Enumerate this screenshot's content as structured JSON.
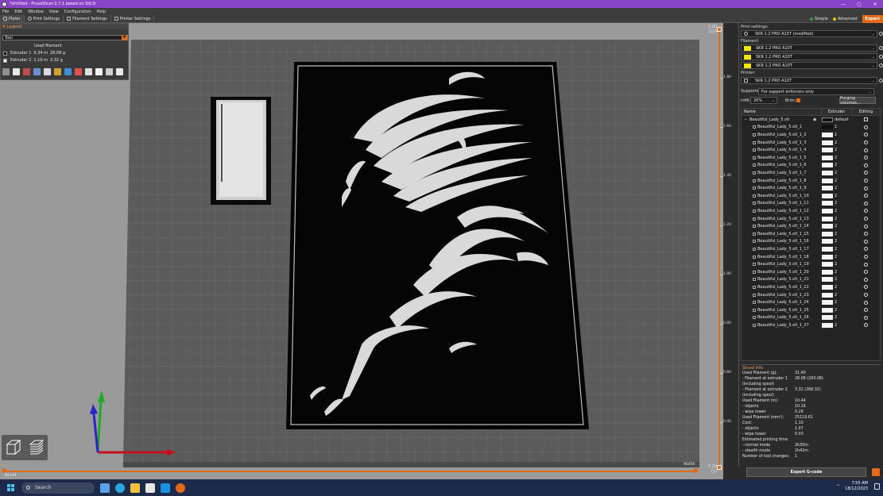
{
  "window": {
    "title": "*Untitled - PrusaSlicer-2.7.1 based on Slic3r",
    "controls": [
      "—",
      "▢",
      "✕"
    ]
  },
  "menu": [
    "File",
    "Edit",
    "Window",
    "View",
    "Configuration",
    "Help"
  ],
  "tabs": [
    "Plater",
    "Print Settings",
    "Filament Settings",
    "Printer Settings"
  ],
  "modes": {
    "simple": "Simple",
    "advanced": "Advanced",
    "expert": "Expert",
    "simple_color": "#3aa33a",
    "advanced_color": "#e6c400"
  },
  "legend": {
    "title": "Legend",
    "view_type": "Tool",
    "used_filament_label": "Used filament",
    "extruders": [
      {
        "name": "Extruder 1",
        "length": "9.34 m",
        "weight": "28.08 g",
        "color": "#000000"
      },
      {
        "name": "Extruder 2",
        "length": "1.10 m",
        "weight": "3.32 g",
        "color": "#ffffff"
      }
    ]
  },
  "vslider": {
    "top_value": "2.00",
    "top_layer": "(10)",
    "bottom_value": "0.20",
    "bottom_layer": "(1)",
    "ticks": [
      "1.80",
      "1.60",
      "1.40",
      "1.20",
      "1.00",
      "0.80",
      "0.60",
      "0.40"
    ]
  },
  "hslider": {
    "left_value": "84149",
    "right_value": "96056"
  },
  "right_panel": {
    "print_settings_label": "Print settings:",
    "print_profile": "SKR 1.2 PRO A10T (modified)",
    "filament_label": "Filament:",
    "filaments": [
      {
        "name": "SKR 1.2 PRO A10T",
        "color": "#f2e600"
      },
      {
        "name": "SKR 1.2 PRO A10T",
        "color": "#f2e600"
      },
      {
        "name": "SKR 1.2 PRO A10T",
        "color": "#f2e600"
      }
    ],
    "printer_label": "Printer:",
    "printer_profile": "SKR 1.2 PRO A10T",
    "supports_label": "Supports:",
    "supports_value": "For support enforcers only",
    "infill_label": "Infill:",
    "infill_value": "20%",
    "brim_label": "Brim:",
    "purging_button": "Purging volumes...",
    "columns": {
      "name": "Name",
      "extruder": "Extruder",
      "editing": "Editing"
    },
    "parent_object": {
      "name": "Beautiful_Lady_5.stl",
      "extruder": "default"
    },
    "parts": [
      {
        "name": "Beautiful_Lady_5.stl_1",
        "extruder": "1",
        "color": "#111111"
      },
      {
        "name": "Beautiful_Lady_5.stl_1_2",
        "extruder": "2",
        "color": "#f4f4f4"
      },
      {
        "name": "Beautiful_Lady_5.stl_1_3",
        "extruder": "2",
        "color": "#f4f4f4"
      },
      {
        "name": "Beautiful_Lady_5.stl_1_4",
        "extruder": "2",
        "color": "#f4f4f4"
      },
      {
        "name": "Beautiful_Lady_5.stl_1_5",
        "extruder": "2",
        "color": "#f4f4f4"
      },
      {
        "name": "Beautiful_Lady_5.stl_1_6",
        "extruder": "2",
        "color": "#f4f4f4"
      },
      {
        "name": "Beautiful_Lady_5.stl_1_7",
        "extruder": "2",
        "color": "#f4f4f4"
      },
      {
        "name": "Beautiful_Lady_5.stl_1_8",
        "extruder": "2",
        "color": "#f4f4f4"
      },
      {
        "name": "Beautiful_Lady_5.stl_1_9",
        "extruder": "2",
        "color": "#f4f4f4"
      },
      {
        "name": "Beautiful_Lady_5.stl_1_10",
        "extruder": "2",
        "color": "#f4f4f4"
      },
      {
        "name": "Beautiful_Lady_5.stl_1_11",
        "extruder": "2",
        "color": "#f4f4f4"
      },
      {
        "name": "Beautiful_Lady_5.stl_1_12",
        "extruder": "2",
        "color": "#f4f4f4"
      },
      {
        "name": "Beautiful_Lady_5.stl_1_13",
        "extruder": "2",
        "color": "#f4f4f4"
      },
      {
        "name": "Beautiful_Lady_5.stl_1_14",
        "extruder": "2",
        "color": "#f4f4f4"
      },
      {
        "name": "Beautiful_Lady_5.stl_1_15",
        "extruder": "2",
        "color": "#f4f4f4"
      },
      {
        "name": "Beautiful_Lady_5.stl_1_16",
        "extruder": "2",
        "color": "#f4f4f4"
      },
      {
        "name": "Beautiful_Lady_5.stl_1_17",
        "extruder": "2",
        "color": "#f4f4f4"
      },
      {
        "name": "Beautiful_Lady_5.stl_1_18",
        "extruder": "2",
        "color": "#f4f4f4"
      },
      {
        "name": "Beautiful_Lady_5.stl_1_19",
        "extruder": "2",
        "color": "#f4f4f4"
      },
      {
        "name": "Beautiful_Lady_5.stl_1_20",
        "extruder": "2",
        "color": "#f4f4f4"
      },
      {
        "name": "Beautiful_Lady_5.stl_1_21",
        "extruder": "2",
        "color": "#f4f4f4"
      },
      {
        "name": "Beautiful_Lady_5.stl_1_22",
        "extruder": "2",
        "color": "#f4f4f4"
      },
      {
        "name": "Beautiful_Lady_5.stl_1_23",
        "extruder": "2",
        "color": "#f4f4f4"
      },
      {
        "name": "Beautiful_Lady_5.stl_1_24",
        "extruder": "2",
        "color": "#f4f4f4"
      },
      {
        "name": "Beautiful_Lady_5.stl_1_25",
        "extruder": "2",
        "color": "#f4f4f4"
      },
      {
        "name": "Beautiful_Lady_5.stl_1_26",
        "extruder": "2",
        "color": "#f4f4f4"
      },
      {
        "name": "Beautiful_Lady_5.stl_1_27",
        "extruder": "2",
        "color": "#f4f4f4"
      }
    ]
  },
  "sliced_info": {
    "title": "Sliced Info",
    "rows": [
      {
        "label": "Used Filament (g):",
        "value": "31.40"
      },
      {
        "label": "  - Filament at extruder 1",
        "value": "28.08 (293.08)"
      },
      {
        "label": "    (including spool)",
        "value": ""
      },
      {
        "label": "  - Filament at extruder 2",
        "value": "3.32 (268.32)"
      },
      {
        "label": "    (including spool)",
        "value": ""
      },
      {
        "label": "Used Filament (m):",
        "value": "10.44"
      },
      {
        "label": "  - objects",
        "value": "10.16"
      },
      {
        "label": "  - wipe tower",
        "value": "0.29"
      },
      {
        "label": "Used Filament (mm³):",
        "value": "25119.61"
      },
      {
        "label": "Cost:",
        "value": "1.10"
      },
      {
        "label": "  - objects",
        "value": "1.07"
      },
      {
        "label": "  - wipe tower",
        "value": "0.03"
      },
      {
        "label": "Estimated printing time:",
        "value": ""
      },
      {
        "label": "  - normal mode",
        "value": "2h30m"
      },
      {
        "label": "  - stealth mode",
        "value": "2h42m"
      },
      {
        "label": "Number of tool changes:",
        "value": "1"
      }
    ]
  },
  "export_button": "Export G-code",
  "taskbar": {
    "search_placeholder": "Search",
    "time": "7:55 AM",
    "date": "18/12/2023"
  }
}
